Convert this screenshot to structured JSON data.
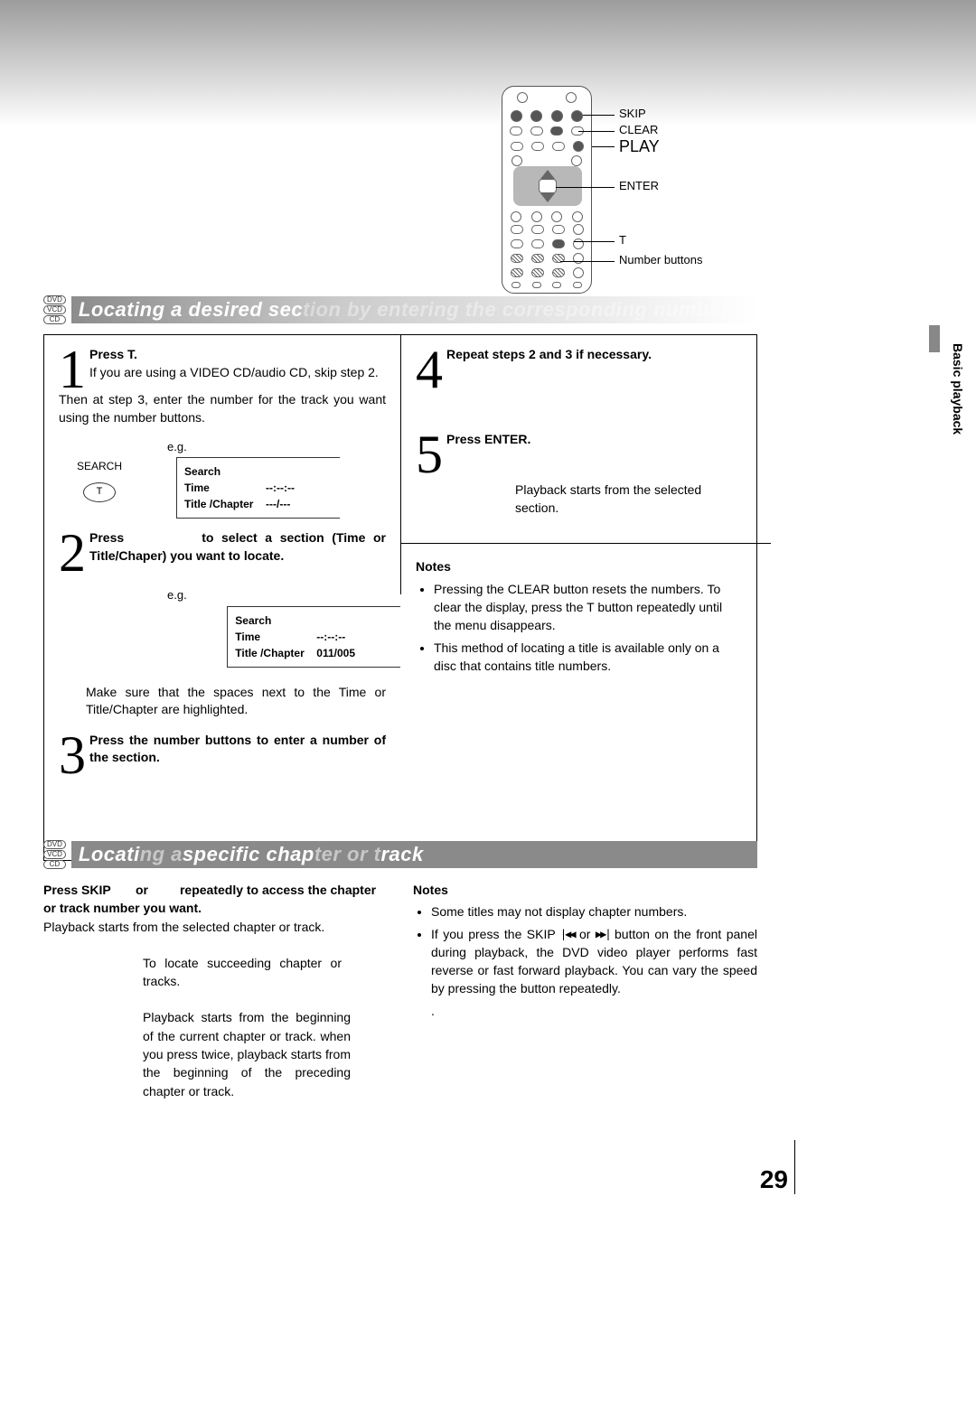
{
  "remote": {
    "labels": {
      "skip": "SKIP",
      "clear": "CLEAR",
      "play": "PLAY",
      "enter": "ENTER",
      "t": "T",
      "numbers": "Number buttons"
    }
  },
  "badges": [
    "DVD",
    "VCD",
    "CD"
  ],
  "section1": {
    "title_a": "Locating a desired sec",
    "title_b": "tion by entering the corresponding number",
    "step1_head": "Press T.",
    "step1_body1": "If you are using a VIDEO CD/audio CD, skip step 2.",
    "step1_body2": "Then at step 3, enter the number for the track you want using the number buttons.",
    "eg": "e.g.",
    "search_label": "SEARCH",
    "t_label": "T",
    "box1": {
      "k1": "Search",
      "v1": "",
      "k2": "Time",
      "v2": "--:--:--",
      "k3": "Title /Chapter",
      "v3": "---/---"
    },
    "step2_head_a": "Press",
    "step2_head_b": "to select a section (Time or Title/Chaper) you want to locate.",
    "box2": {
      "k1": "Search",
      "v1": "",
      "k2": "Time",
      "v2": "--:--:--",
      "k3": "Title /Chapter",
      "v3": "011/005"
    },
    "step2_note": "Make sure that the spaces next to the Time or Title/Chapter are highlighted.",
    "step3_head": "Press the number buttons to enter a number of the section.",
    "step4_head": "Repeat steps 2 and 3 if necessary.",
    "step5_head": "Press ENTER.",
    "step5_body": "Playback starts from the selected section.",
    "notes_head": "Notes",
    "notes": [
      "Pressing the CLEAR button resets the numbers. To clear the display, press the T button repeatedly until the menu disappears.",
      "This method of locating a title is available only on a disc that contains title numbers."
    ]
  },
  "section2": {
    "title_a": "Locati",
    "title_b": "ng a ",
    "title_c": "specific chap",
    "title_d": "ter or t",
    "title_e": "rack",
    "head_a": "Press SKIP",
    "head_b": "or",
    "head_c": "repeatedly to access the chapter or track number you want.",
    "body": "Playback starts from the selected chapter or track.",
    "succeed": "To locate succeeding chapter or tracks.",
    "begin": "Playback starts from the beginning of the current chapter or track. when you press twice, playback starts from the beginning of the preceding chapter or track.",
    "notes_head": "Notes",
    "notes": [
      "Some titles may not display chapter numbers.",
      "If you press the SKIP |◀◀ or ▶▶| button on the front panel during playback, the DVD video player performs fast reverse or fast forward playback. You can vary the speed by pressing the button repeatedly."
    ],
    "dot": "."
  },
  "side_label": "Basic playback",
  "page_number": "29"
}
